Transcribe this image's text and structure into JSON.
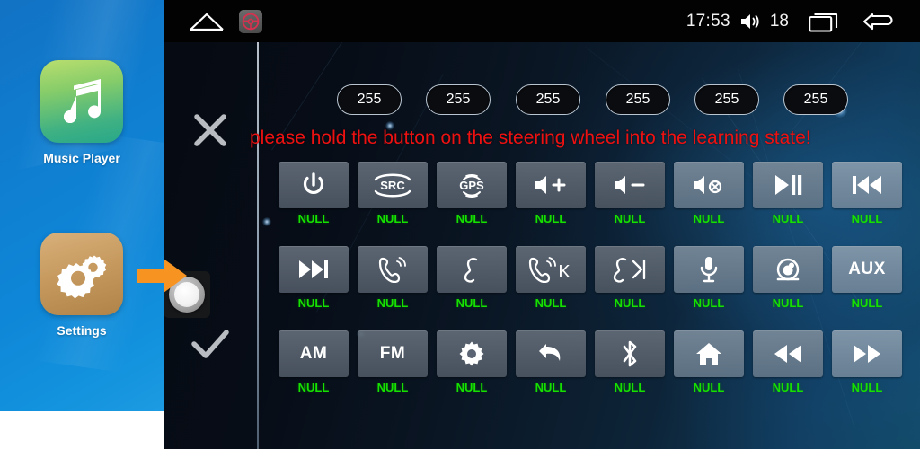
{
  "launcher": {
    "apps": [
      {
        "label": "Music Player",
        "icon": "music-note-icon"
      },
      {
        "label": "Settings",
        "icon": "gears-icon"
      }
    ],
    "pointer_arrow": "orange-right-arrow-icon",
    "knob": "rotary-knob-icon"
  },
  "statusbar": {
    "home_icon": "home-outline-icon",
    "steering_wheel_icon": "steering-wheel-icon",
    "clock": "17:53",
    "volume_icon": "volume-icon",
    "volume_value": "18",
    "recents_icon": "recents-icon",
    "back_icon": "back-arrow-icon"
  },
  "tools": {
    "cancel": {
      "name": "close-icon",
      "label": "X"
    },
    "confirm": {
      "name": "check-icon",
      "label": "OK"
    }
  },
  "values": {
    "pills": [
      "255",
      "255",
      "255",
      "255",
      "255",
      "255"
    ]
  },
  "warning": {
    "text": "please hold the button on the steering wheel into the learning state!",
    "color": "#ee1111"
  },
  "grid": {
    "null_label": "NULL",
    "null_color": "#16e000",
    "rows": [
      [
        {
          "icon": "power-icon",
          "text": "",
          "label": "NULL",
          "tone": "dark"
        },
        {
          "icon": "src-icon",
          "text": "SRC",
          "label": "NULL",
          "tone": "dark"
        },
        {
          "icon": "gps-icon",
          "text": "GPS",
          "label": "NULL",
          "tone": "dark"
        },
        {
          "icon": "volume-up-icon",
          "text": "",
          "label": "NULL",
          "tone": "dark"
        },
        {
          "icon": "volume-down-icon",
          "text": "",
          "label": "NULL",
          "tone": "dark"
        },
        {
          "icon": "mute-icon",
          "text": "",
          "label": "NULL",
          "tone": "lite"
        },
        {
          "icon": "play-pause-icon",
          "text": "",
          "label": "NULL",
          "tone": "lite"
        },
        {
          "icon": "previous-track-icon",
          "text": "",
          "label": "NULL",
          "tone": "lite2"
        }
      ],
      [
        {
          "icon": "next-track-icon",
          "text": "",
          "label": "NULL",
          "tone": "dark"
        },
        {
          "icon": "phone-answer-icon",
          "text": "",
          "label": "NULL",
          "tone": "dark"
        },
        {
          "icon": "phone-hangup-icon",
          "text": "",
          "label": "NULL",
          "tone": "dark"
        },
        {
          "icon": "phone-answer-k-icon",
          "text": "K",
          "label": "NULL",
          "tone": "dark"
        },
        {
          "icon": "phone-hangup-skip-icon",
          "text": "",
          "label": "NULL",
          "tone": "dark"
        },
        {
          "icon": "microphone-icon",
          "text": "",
          "label": "NULL",
          "tone": "lite"
        },
        {
          "icon": "camera-icon",
          "text": "",
          "label": "NULL",
          "tone": "lite"
        },
        {
          "icon": "aux-icon",
          "text": "AUX",
          "label": "NULL",
          "tone": "lite2"
        }
      ],
      [
        {
          "icon": "am-icon",
          "text": "AM",
          "label": "NULL",
          "tone": "dark"
        },
        {
          "icon": "fm-icon",
          "text": "FM",
          "label": "NULL",
          "tone": "dark"
        },
        {
          "icon": "brightness-icon",
          "text": "",
          "label": "NULL",
          "tone": "dark"
        },
        {
          "icon": "undo-back-icon",
          "text": "",
          "label": "NULL",
          "tone": "dark"
        },
        {
          "icon": "bluetooth-icon",
          "text": "",
          "label": "NULL",
          "tone": "dark"
        },
        {
          "icon": "home-icon",
          "text": "",
          "label": "NULL",
          "tone": "lite"
        },
        {
          "icon": "rewind-icon",
          "text": "",
          "label": "NULL",
          "tone": "lite"
        },
        {
          "icon": "fast-forward-icon",
          "text": "",
          "label": "NULL",
          "tone": "lite2"
        }
      ]
    ]
  }
}
